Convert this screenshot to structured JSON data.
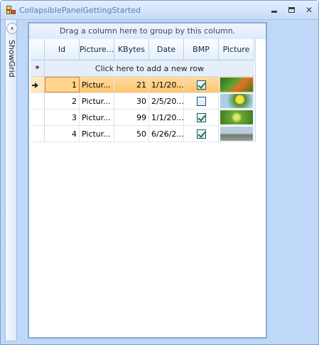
{
  "window": {
    "title": "CollapsiblePanelGettingStarted",
    "buttons": {
      "minimize": "",
      "maximize": "",
      "close": "✕"
    }
  },
  "side_panel": {
    "label": "ShowGrid",
    "expand_glyph": "‹"
  },
  "grid": {
    "group_panel_text": "Drag a column here to group by this column.",
    "new_row_text": "Click here to add a new row",
    "new_row_glyph": "*",
    "columns": [
      "Id",
      "Picture...",
      "KBytes",
      "Date",
      "BMP",
      "Picture"
    ],
    "rows": [
      {
        "id": "1",
        "picture_name": "Pictur...",
        "kbytes": "21",
        "date": "1/1/20...",
        "bmp": true,
        "thumb": "flower-orange"
      },
      {
        "id": "2",
        "picture_name": "Pictur...",
        "kbytes": "30",
        "date": "2/5/20...",
        "bmp": false,
        "thumb": "flower-yellow"
      },
      {
        "id": "3",
        "picture_name": "Pictur...",
        "kbytes": "99",
        "date": "1/1/20...",
        "bmp": true,
        "thumb": "leaves-green"
      },
      {
        "id": "4",
        "picture_name": "Pictur...",
        "kbytes": "50",
        "date": "6/26/2...",
        "bmp": true,
        "thumb": "mountain-lake"
      }
    ],
    "selected_row": 0
  },
  "colors": {
    "window_bg": "#bfd8f8",
    "selection": "#ffc56a",
    "current_cell_border": "#e27a2a",
    "header_bg": "#e3eefb"
  }
}
